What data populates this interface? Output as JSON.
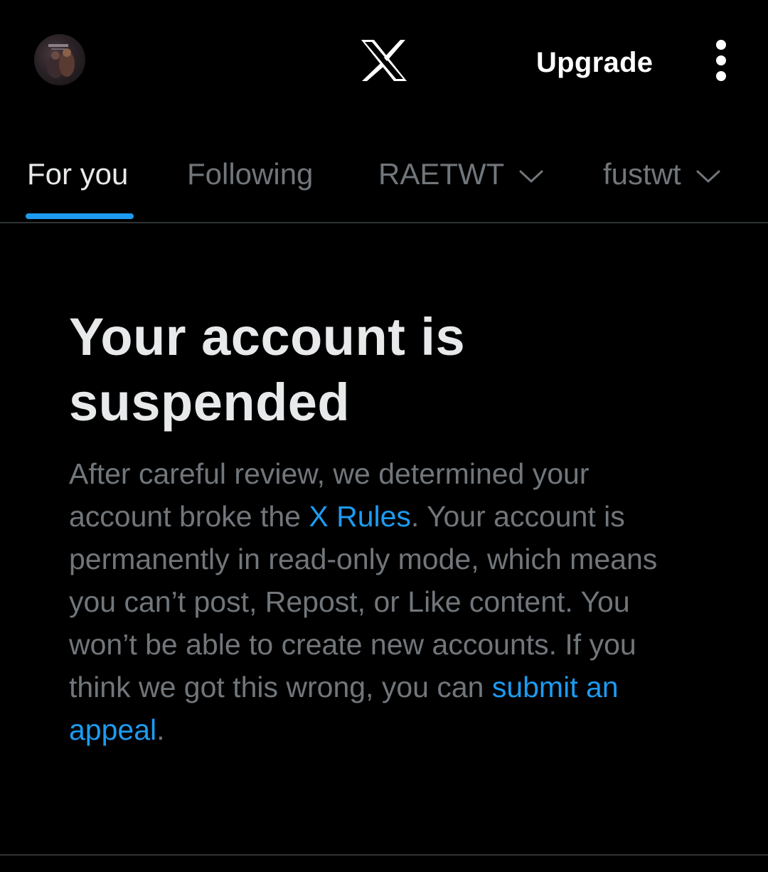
{
  "header": {
    "avatar_icon": "profile-avatar",
    "logo_icon": "x-logo-icon",
    "upgrade_label": "Upgrade",
    "more_icon": "more-vertical-icon"
  },
  "tabs": [
    {
      "label": "For you",
      "active": true
    },
    {
      "label": "Following",
      "active": false
    },
    {
      "label": "RAETWT",
      "active": false,
      "has_dropdown": true
    },
    {
      "label": "fustwt",
      "active": false,
      "has_dropdown": true
    }
  ],
  "notice": {
    "title": "Your account is suspended",
    "body_part1": "After careful review, we determined your account broke the ",
    "rules_link": "X Rules",
    "body_part2": ". Your account is permanently in read-only mode, which means you can’t post, Repost, or Like content. You won’t be able to create new accounts. If you think we got this wrong, you can ",
    "appeal_link": "submit an appeal",
    "body_part3": "."
  },
  "colors": {
    "background": "#000000",
    "accent": "#1d9bf0",
    "primary_text": "#e7e9ea",
    "secondary_text": "#71767b",
    "divider": "#2f3336"
  }
}
